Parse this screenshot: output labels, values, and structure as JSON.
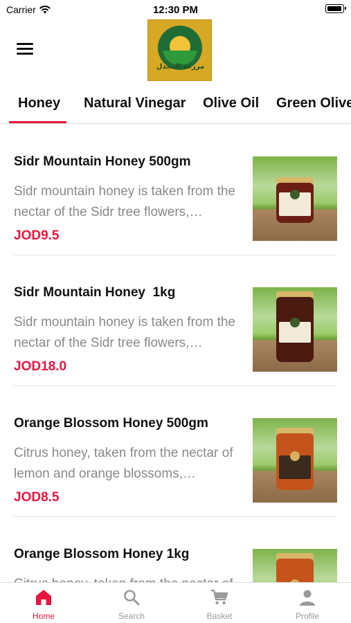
{
  "status_bar": {
    "carrier": "Carrier",
    "time": "12:30 PM"
  },
  "header": {
    "logo_text": "مزرعة المجدل"
  },
  "tabs": [
    {
      "label": "Honey",
      "active": true
    },
    {
      "label": "Natural Vinegar",
      "active": false
    },
    {
      "label": "Olive Oil",
      "active": false
    },
    {
      "label": "Green Olive",
      "active": false
    }
  ],
  "products": [
    {
      "title": "Sidr Mountain Honey 500gm",
      "description": "Sidr mountain honey is taken from the nectar of the Sidr tree flowers,…",
      "price": "JOD9.5",
      "image_icon": "honey-jar-small"
    },
    {
      "title": "Sidr Mountain Honey  1kg",
      "description": "Sidr mountain honey is taken from the nectar of the Sidr tree flowers,…",
      "price": "JOD18.0",
      "image_icon": "honey-jar-large"
    },
    {
      "title": "Orange Blossom Honey 500gm",
      "description": "Citrus honey, taken from the nectar of lemon and orange blossoms,…",
      "price": "JOD8.5",
      "image_icon": "honey-jar-orange"
    },
    {
      "title": "Orange Blossom Honey 1kg",
      "description": "Citrus honey, taken from the nectar of lemon and orange blossoms,…",
      "price": "",
      "image_icon": "honey-jar-orange-large"
    }
  ],
  "bottom_nav": [
    {
      "label": "Home",
      "icon": "home-icon",
      "active": true
    },
    {
      "label": "Search",
      "icon": "search-icon",
      "active": false
    },
    {
      "label": "Basket",
      "icon": "cart-icon",
      "active": false
    },
    {
      "label": "Profile",
      "icon": "person-icon",
      "active": false
    }
  ],
  "colors": {
    "accent": "#e8163f",
    "muted_text": "#8a8a8a",
    "logo_background": "#d6a824"
  }
}
